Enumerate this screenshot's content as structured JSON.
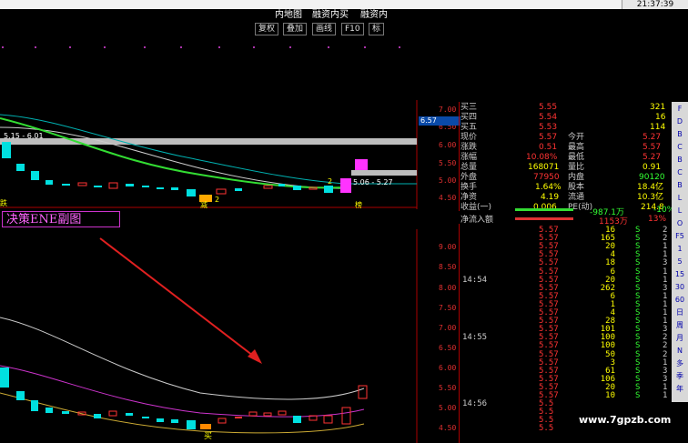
{
  "window": {
    "clock": "21:37:39"
  },
  "menu": [
    {
      "label": "内地图"
    },
    {
      "label": "融资内买"
    },
    {
      "label": "融资内"
    }
  ],
  "toolbar": [
    {
      "label": "复权"
    },
    {
      "label": "叠加"
    },
    {
      "label": "画线"
    },
    {
      "label": "F10"
    },
    {
      "label": "标"
    }
  ],
  "main_chart": {
    "price_axis": [
      "7.00",
      "6.50",
      "6.00",
      "5.50",
      "5.00",
      "4.50"
    ],
    "current_price_tag": "6.57",
    "band_left_label": "5.15 - 6.01",
    "band_right_label": "5.06 - 5.27",
    "markers": {
      "left": "跌",
      "buy": "减",
      "buy2": "2",
      "b2": "2",
      "right": "榜"
    }
  },
  "sub_chart": {
    "title": "决策ENE副图",
    "axis": [
      "9.00",
      "8.50",
      "8.00",
      "7.50",
      "7.00",
      "6.50",
      "6.00",
      "5.50",
      "5.00",
      "4.50"
    ],
    "marker": "买"
  },
  "quote_panel": {
    "rows": [
      {
        "label": "买三",
        "value": "5.55",
        "right_label": "",
        "right_value": "321"
      },
      {
        "label": "买四",
        "value": "5.54",
        "right_label": "",
        "right_value": "16"
      },
      {
        "label": "买五",
        "value": "5.53",
        "right_label": "",
        "right_value": "114"
      },
      {
        "label": "现价",
        "value": "5.57",
        "right_label": "今开",
        "right_value": "5.27"
      },
      {
        "label": "涨跌",
        "value": "0.51",
        "right_label": "最高",
        "right_value": "5.57"
      },
      {
        "label": "涨幅",
        "value": "10.08%",
        "right_label": "最低",
        "right_value": "5.27"
      },
      {
        "label": "总量",
        "value": "168071",
        "right_label": "量比",
        "right_value": "0.91"
      },
      {
        "label": "外盘",
        "value": "77950",
        "right_label": "内盘",
        "right_value": "90120"
      },
      {
        "label": "换手",
        "value": "1.64%",
        "right_label": "股本",
        "right_value": "18.4亿"
      },
      {
        "label": "净资",
        "value": "4.19",
        "right_label": "流通",
        "right_value": "10.3亿"
      },
      {
        "label": "收益(一)",
        "value": "0.006",
        "right_label": "PE(动)",
        "right_value": "214.8"
      }
    ],
    "net_inflow_label": "净流入额",
    "flow_rows": [
      {
        "value": "-987.1万",
        "pct": "-10%"
      },
      {
        "value": "1153万",
        "pct": "13%"
      }
    ]
  },
  "ticks": [
    {
      "time": "",
      "price": "5.57",
      "vol": "16",
      "side": "S",
      "n": "2"
    },
    {
      "time": "",
      "price": "5.57",
      "vol": "165",
      "side": "S",
      "n": "2"
    },
    {
      "time": "",
      "price": "5.57",
      "vol": "20",
      "side": "S",
      "n": "1"
    },
    {
      "time": "",
      "price": "5.57",
      "vol": "4",
      "side": "S",
      "n": "1"
    },
    {
      "time": "",
      "price": "5.57",
      "vol": "18",
      "side": "S",
      "n": "3"
    },
    {
      "time": "",
      "price": "5.57",
      "vol": "6",
      "side": "S",
      "n": "1"
    },
    {
      "time": "14:54",
      "price": "5.57",
      "vol": "20",
      "side": "S",
      "n": "1"
    },
    {
      "time": "",
      "price": "5.57",
      "vol": "262",
      "side": "S",
      "n": "3"
    },
    {
      "time": "",
      "price": "5.57",
      "vol": "6",
      "side": "S",
      "n": "1"
    },
    {
      "time": "",
      "price": "5.57",
      "vol": "1",
      "side": "S",
      "n": "1"
    },
    {
      "time": "",
      "price": "5.57",
      "vol": "4",
      "side": "S",
      "n": "1"
    },
    {
      "time": "",
      "price": "5.57",
      "vol": "28",
      "side": "S",
      "n": "1"
    },
    {
      "time": "",
      "price": "5.57",
      "vol": "101",
      "side": "S",
      "n": "3"
    },
    {
      "time": "14:55",
      "price": "5.57",
      "vol": "100",
      "side": "S",
      "n": "2"
    },
    {
      "time": "",
      "price": "5.57",
      "vol": "100",
      "side": "S",
      "n": "2"
    },
    {
      "time": "",
      "price": "5.57",
      "vol": "50",
      "side": "S",
      "n": "2"
    },
    {
      "time": "",
      "price": "5.57",
      "vol": "3",
      "side": "S",
      "n": "1"
    },
    {
      "time": "",
      "price": "5.57",
      "vol": "61",
      "side": "S",
      "n": "3"
    },
    {
      "time": "",
      "price": "5.57",
      "vol": "106",
      "side": "S",
      "n": "3"
    },
    {
      "time": "",
      "price": "5.57",
      "vol": "20",
      "side": "S",
      "n": "1"
    },
    {
      "time": "",
      "price": "5.57",
      "vol": "10",
      "side": "S",
      "n": "1"
    },
    {
      "time": "14:56",
      "price": "5.5",
      "vol": "",
      "side": "",
      "n": ""
    },
    {
      "time": "",
      "price": "5.5",
      "vol": "",
      "side": "",
      "n": ""
    },
    {
      "time": "",
      "price": "5.5",
      "vol": "",
      "side": "",
      "n": ""
    },
    {
      "time": "",
      "price": "5.5",
      "vol": "",
      "side": "",
      "n": ""
    }
  ],
  "sidebar": [
    {
      "label": "F"
    },
    {
      "label": "D"
    },
    {
      "label": "B"
    },
    {
      "label": "C"
    },
    {
      "label": "B"
    },
    {
      "label": "C"
    },
    {
      "label": "B"
    },
    {
      "label": "L"
    },
    {
      "label": "L"
    },
    {
      "label": "O"
    },
    {
      "label": "F5"
    },
    {
      "label": "1"
    },
    {
      "label": "5"
    },
    {
      "label": "15"
    },
    {
      "label": "30"
    },
    {
      "label": "60"
    },
    {
      "label": "日"
    },
    {
      "label": "周"
    },
    {
      "label": "月"
    },
    {
      "label": "N"
    },
    {
      "label": "多"
    },
    {
      "label": "季"
    },
    {
      "label": "年"
    }
  ],
  "watermark": "www.7gpzb.com",
  "colors": {
    "up": "#ff3333",
    "down": "#00e0e0",
    "text_yellow": "#ffff00",
    "magenta": "#ff33ff",
    "green": "#33ff33"
  }
}
